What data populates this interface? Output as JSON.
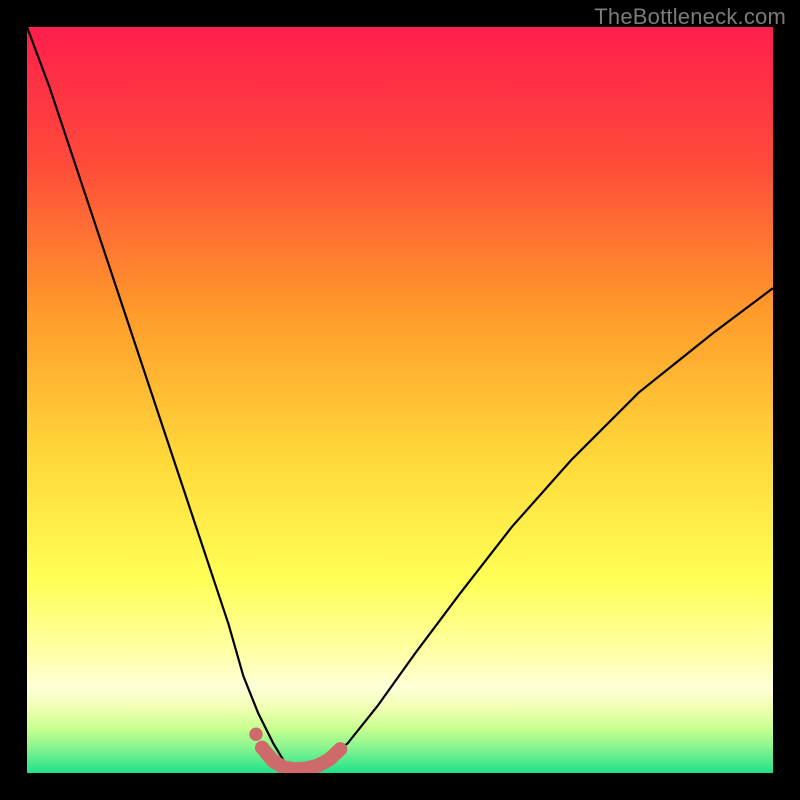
{
  "watermark": "TheBottleneck.com",
  "colors": {
    "frame": "#000000",
    "gradient_top": "#ff1f4c",
    "gradient_mid_upper": "#ff7a2b",
    "gradient_mid": "#ffe83a",
    "gradient_lower": "#f3ff6a",
    "gradient_band": "#ffffcf",
    "gradient_green1": "#b7ff7a",
    "gradient_green2": "#5cf38f",
    "gradient_bottom": "#1fe28a",
    "curve": "#000000",
    "marker_fill": "#cf6a6a",
    "marker_stroke": "#cf6a6a"
  },
  "chart_data": {
    "type": "line",
    "title": "",
    "xlabel": "",
    "ylabel": "",
    "xlim": [
      0,
      100
    ],
    "ylim": [
      0,
      100
    ],
    "series": [
      {
        "name": "bottleneck-curve",
        "x": [
          0,
          3,
          6,
          9,
          12,
          15,
          18,
          21,
          24,
          27,
          29,
          31,
          33,
          34.5,
          36,
          38,
          40,
          43,
          47,
          52,
          58,
          65,
          73,
          82,
          92,
          100
        ],
        "y": [
          100,
          92,
          83,
          74,
          65,
          56,
          47,
          38,
          29,
          20,
          13,
          8,
          4,
          1.5,
          0.5,
          0.5,
          1.5,
          4,
          9,
          16,
          24,
          33,
          42,
          51,
          59,
          65
        ]
      }
    ],
    "markers": {
      "name": "highlight-band",
      "x": [
        31.5,
        33,
        34.5,
        36,
        37.5,
        39,
        40.5,
        42
      ],
      "y": [
        3.4,
        1.6,
        0.7,
        0.5,
        0.6,
        1.0,
        1.8,
        3.2
      ],
      "special_point": {
        "x": 30.7,
        "y": 5.2
      }
    }
  }
}
